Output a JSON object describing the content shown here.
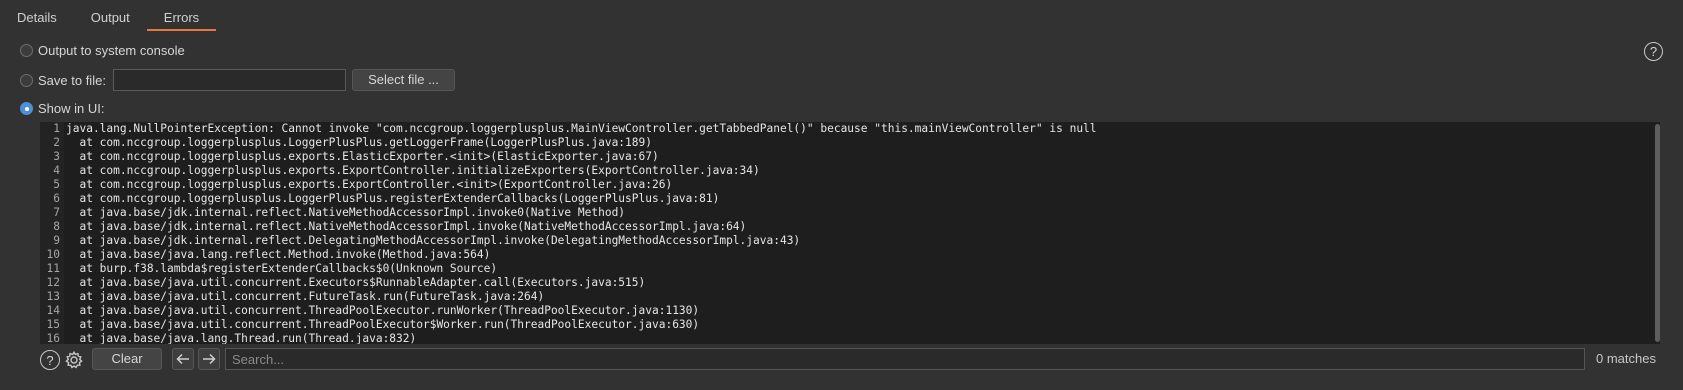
{
  "tabs": [
    {
      "label": "Details"
    },
    {
      "label": "Output"
    },
    {
      "label": "Errors"
    }
  ],
  "active_tab": "Errors",
  "accent_color": "#e8773d",
  "selection_color": "#4f8fd6",
  "options": {
    "system_console_label": "Output to system console",
    "save_to_file_label": "Save to file:",
    "file_path_value": "",
    "select_file_label": "Select file ...",
    "show_in_ui_label": "Show in UI:",
    "selected": "show_in_ui"
  },
  "help_icon": "?",
  "editor": {
    "lines": [
      {
        "num": "1",
        "text": "java.lang.NullPointerException: Cannot invoke \"com.nccgroup.loggerplusplus.MainViewController.getTabbedPanel()\" because \"this.mainViewController\" is null"
      },
      {
        "num": "2",
        "text": "  at com.nccgroup.loggerplusplus.LoggerPlusPlus.getLoggerFrame(LoggerPlusPlus.java:189)"
      },
      {
        "num": "3",
        "text": "  at com.nccgroup.loggerplusplus.exports.ElasticExporter.<init>(ElasticExporter.java:67)"
      },
      {
        "num": "4",
        "text": "  at com.nccgroup.loggerplusplus.exports.ExportController.initializeExporters(ExportController.java:34)"
      },
      {
        "num": "5",
        "text": "  at com.nccgroup.loggerplusplus.exports.ExportController.<init>(ExportController.java:26)"
      },
      {
        "num": "6",
        "text": "  at com.nccgroup.loggerplusplus.LoggerPlusPlus.registerExtenderCallbacks(LoggerPlusPlus.java:81)"
      },
      {
        "num": "7",
        "text": "  at java.base/jdk.internal.reflect.NativeMethodAccessorImpl.invoke0(Native Method)"
      },
      {
        "num": "8",
        "text": "  at java.base/jdk.internal.reflect.NativeMethodAccessorImpl.invoke(NativeMethodAccessorImpl.java:64)"
      },
      {
        "num": "9",
        "text": "  at java.base/jdk.internal.reflect.DelegatingMethodAccessorImpl.invoke(DelegatingMethodAccessorImpl.java:43)"
      },
      {
        "num": "10",
        "text": "  at java.base/java.lang.reflect.Method.invoke(Method.java:564)"
      },
      {
        "num": "11",
        "text": "  at burp.f38.lambda$registerExtenderCallbacks$0(Unknown Source)"
      },
      {
        "num": "12",
        "text": "  at java.base/java.util.concurrent.Executors$RunnableAdapter.call(Executors.java:515)"
      },
      {
        "num": "13",
        "text": "  at java.base/java.util.concurrent.FutureTask.run(FutureTask.java:264)"
      },
      {
        "num": "14",
        "text": "  at java.base/java.util.concurrent.ThreadPoolExecutor.runWorker(ThreadPoolExecutor.java:1130)"
      },
      {
        "num": "15",
        "text": "  at java.base/java.util.concurrent.ThreadPoolExecutor$Worker.run(ThreadPoolExecutor.java:630)"
      },
      {
        "num": "16",
        "text": "  at java.base/java.lang.Thread.run(Thread.java:832)"
      }
    ]
  },
  "bottom": {
    "clear_label": "Clear",
    "search_placeholder": "Search...",
    "search_value": "",
    "matches_text": "0 matches"
  }
}
